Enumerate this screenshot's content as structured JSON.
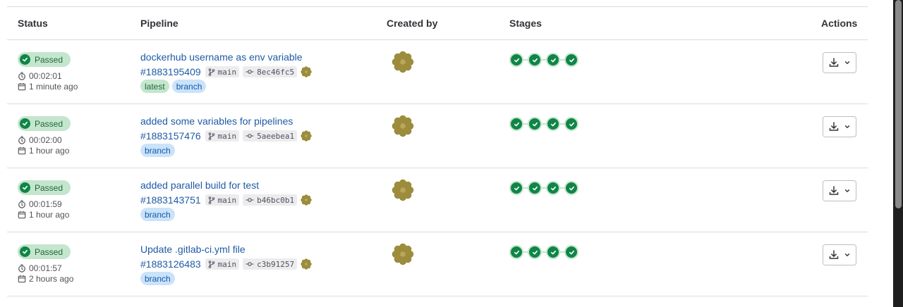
{
  "headers": {
    "status": "Status",
    "pipeline": "Pipeline",
    "created_by": "Created by",
    "stages": "Stages",
    "actions": "Actions"
  },
  "colors": {
    "passed_green": "#108548",
    "link_blue": "#1f5ba6",
    "avatar_olive": "#9c8c3c"
  },
  "icons": {
    "duration": "stopwatch-icon",
    "created": "calendar-icon",
    "branch": "branch-icon",
    "commit": "commit-icon",
    "stage_status": "check-circle-icon",
    "download": "download-icon",
    "dropdown": "chevron-down-icon"
  },
  "rows": [
    {
      "status": "Passed",
      "duration": "00:02:01",
      "created": "1 minute ago",
      "title": "dockerhub username as env variable",
      "pipeline_id": "#1883195409",
      "branch": "main",
      "commit": "8ec46fc5",
      "tags": [
        "latest",
        "branch"
      ]
    },
    {
      "status": "Passed",
      "duration": "00:02:00",
      "created": "1 hour ago",
      "title": "added some variables for pipelines",
      "pipeline_id": "#1883157476",
      "branch": "main",
      "commit": "5aeebea1",
      "tags": [
        "branch"
      ]
    },
    {
      "status": "Passed",
      "duration": "00:01:59",
      "created": "1 hour ago",
      "title": "added parallel build for test",
      "pipeline_id": "#1883143751",
      "branch": "main",
      "commit": "b46bc0b1",
      "tags": [
        "branch"
      ]
    },
    {
      "status": "Passed",
      "duration": "00:01:57",
      "created": "2 hours ago",
      "title": "Update .gitlab-ci.yml file",
      "pipeline_id": "#1883126483",
      "branch": "main",
      "commit": "c3b91257",
      "tags": [
        "branch"
      ]
    }
  ],
  "stages_per_pipeline": 4
}
